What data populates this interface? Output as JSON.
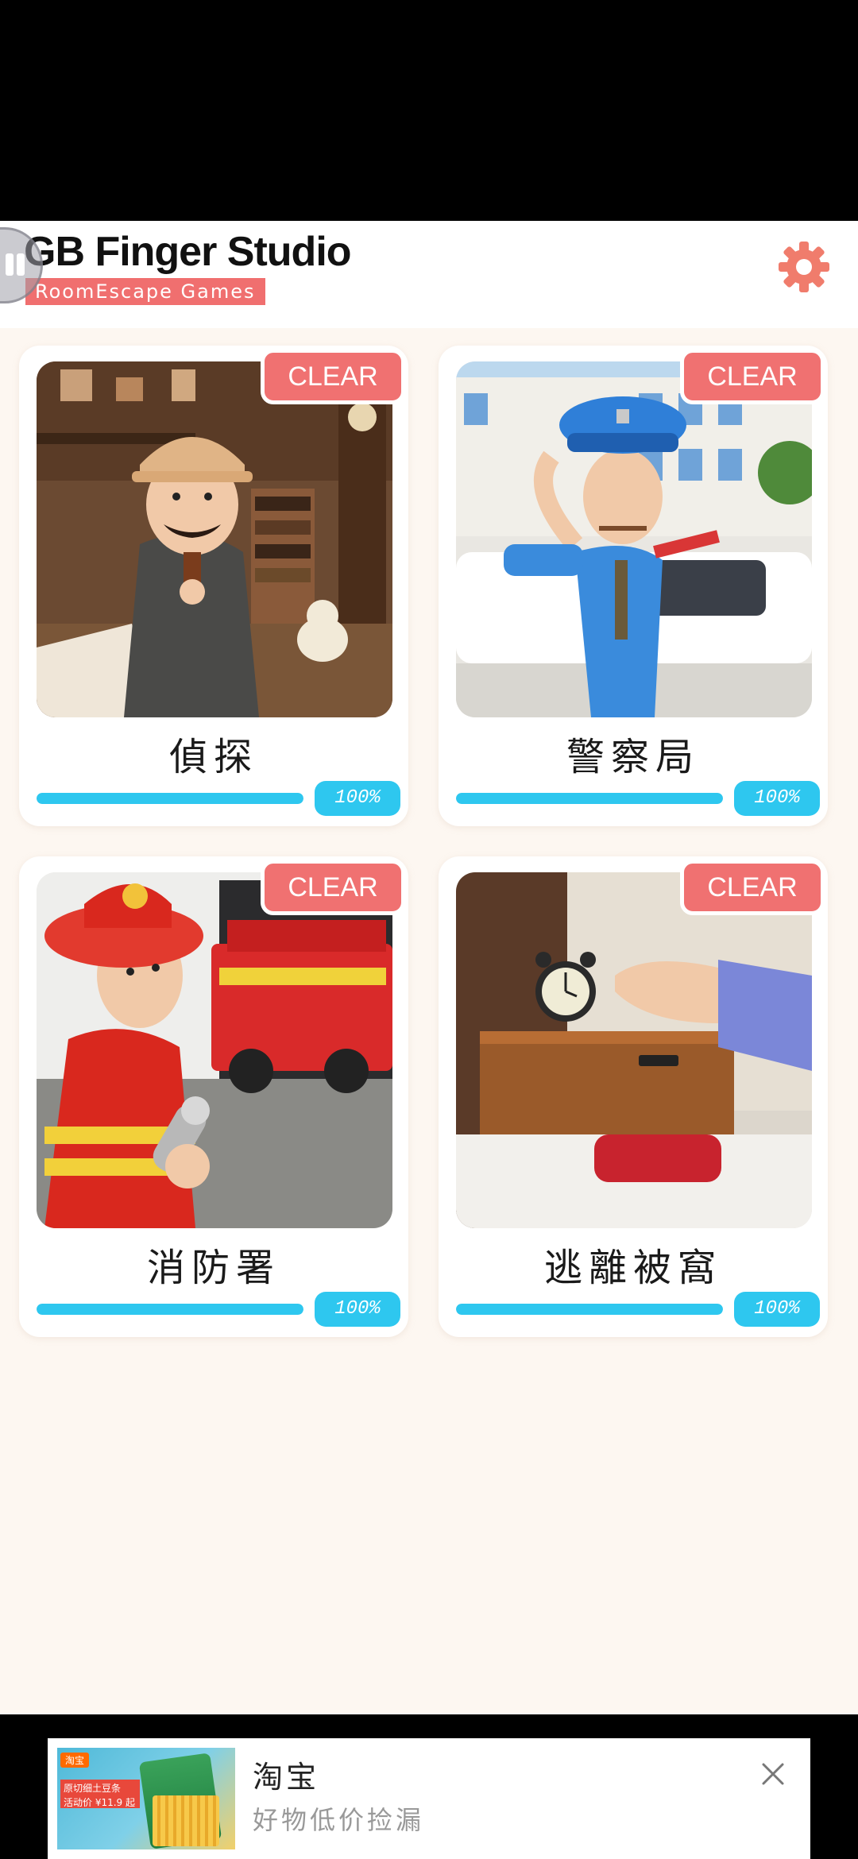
{
  "header": {
    "studio_title": "GB Finger Studio",
    "studio_subtitle": "RoomEscape  Games",
    "settings_icon": "gear-icon",
    "accent_color": "#f06f6f"
  },
  "games": [
    {
      "title": "偵探",
      "badge": "CLEAR",
      "progress_label": "100%",
      "progress": 1.0,
      "scene": "detective"
    },
    {
      "title": "警察局",
      "badge": "CLEAR",
      "progress_label": "100%",
      "progress": 1.0,
      "scene": "police"
    },
    {
      "title": "消防署",
      "badge": "CLEAR",
      "progress_label": "100%",
      "progress": 1.0,
      "scene": "firefighter"
    },
    {
      "title": "逃離被窩",
      "badge": "CLEAR",
      "progress_label": "100%",
      "progress": 1.0,
      "scene": "bedroom"
    }
  ],
  "progress_color": "#2ec7ef",
  "ad": {
    "title": "淘宝",
    "description": "好物低价捡漏",
    "image_tag": "淘宝",
    "image_label_line1": "原切细土豆条",
    "image_label_line2": "活动价 ¥11.9 起",
    "close_icon": "close-icon"
  }
}
